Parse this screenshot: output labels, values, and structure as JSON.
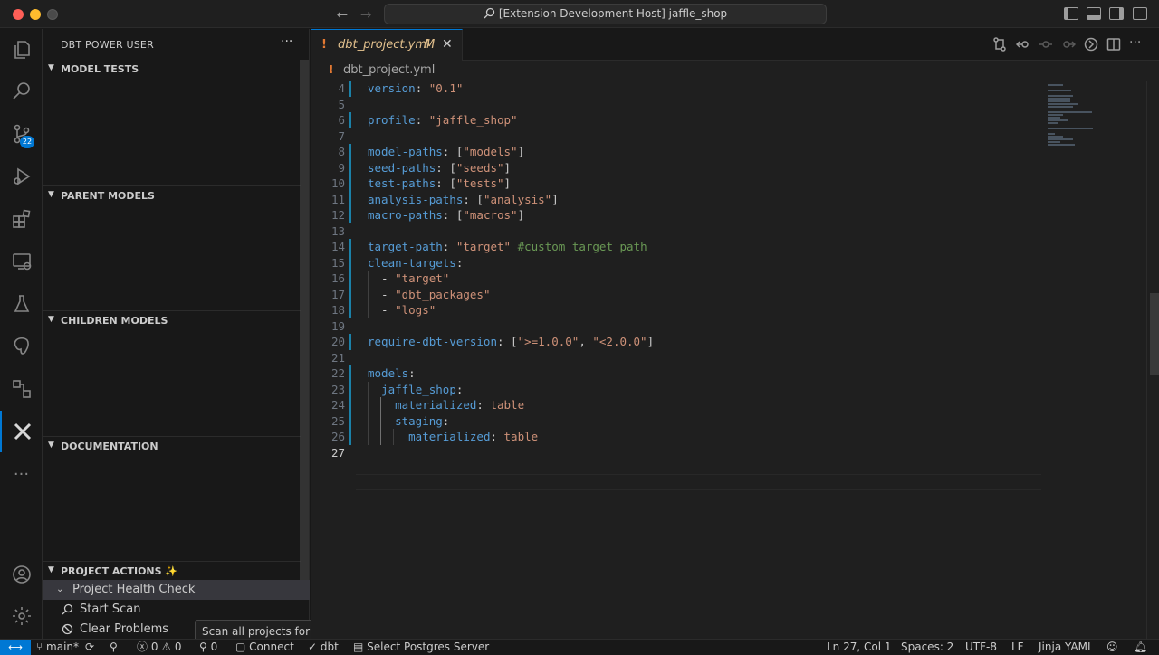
{
  "window": {
    "title": "[Extension Development Host] jaffle_shop"
  },
  "activity": {
    "scm_badge": "22"
  },
  "sidebar": {
    "title": "DBT POWER USER",
    "sections": {
      "model_tests": "MODEL TESTS",
      "parent_models": "PARENT MODELS",
      "children_models": "CHILDREN MODELS",
      "documentation": "DOCUMENTATION",
      "project_actions": "PROJECT ACTIONS ✨"
    },
    "tree": {
      "health_check": "Project Health Check",
      "start_scan": "Start Scan",
      "clear_problems": "Clear Problems"
    },
    "tooltip": "Scan all projects for issues"
  },
  "editor": {
    "tab": {
      "name": "dbt_project.yml",
      "modified": "M"
    },
    "breadcrumb": "dbt_project.yml",
    "lines": [
      {
        "n": "4",
        "t": [
          [
            "k",
            "version"
          ],
          [
            "p",
            ": "
          ],
          [
            "s",
            "\"0.1\""
          ]
        ]
      },
      {
        "n": "5",
        "t": []
      },
      {
        "n": "6",
        "t": [
          [
            "k",
            "profile"
          ],
          [
            "p",
            ": "
          ],
          [
            "s",
            "\"jaffle_shop\""
          ]
        ]
      },
      {
        "n": "7",
        "t": []
      },
      {
        "n": "8",
        "t": [
          [
            "k",
            "model-paths"
          ],
          [
            "p",
            ": ["
          ],
          [
            "s",
            "\"models\""
          ],
          [
            "p",
            "]"
          ]
        ]
      },
      {
        "n": "9",
        "t": [
          [
            "k",
            "seed-paths"
          ],
          [
            "p",
            ": ["
          ],
          [
            "s",
            "\"seeds\""
          ],
          [
            "p",
            "]"
          ]
        ]
      },
      {
        "n": "10",
        "t": [
          [
            "k",
            "test-paths"
          ],
          [
            "p",
            ": ["
          ],
          [
            "s",
            "\"tests\""
          ],
          [
            "p",
            "]"
          ]
        ]
      },
      {
        "n": "11",
        "t": [
          [
            "k",
            "analysis-paths"
          ],
          [
            "p",
            ": ["
          ],
          [
            "s",
            "\"analysis\""
          ],
          [
            "p",
            "]"
          ]
        ]
      },
      {
        "n": "12",
        "t": [
          [
            "k",
            "macro-paths"
          ],
          [
            "p",
            ": ["
          ],
          [
            "s",
            "\"macros\""
          ],
          [
            "p",
            "]"
          ]
        ]
      },
      {
        "n": "13",
        "t": []
      },
      {
        "n": "14",
        "t": [
          [
            "k",
            "target-path"
          ],
          [
            "p",
            ": "
          ],
          [
            "s",
            "\"target\""
          ],
          [
            "p",
            " "
          ],
          [
            "c",
            "#custom target path"
          ]
        ]
      },
      {
        "n": "15",
        "t": [
          [
            "k",
            "clean-targets"
          ],
          [
            "p",
            ":"
          ]
        ]
      },
      {
        "n": "16",
        "t": [
          [
            "p",
            "  - "
          ],
          [
            "s",
            "\"target\""
          ]
        ]
      },
      {
        "n": "17",
        "t": [
          [
            "p",
            "  - "
          ],
          [
            "s",
            "\"dbt_packages\""
          ]
        ]
      },
      {
        "n": "18",
        "t": [
          [
            "p",
            "  - "
          ],
          [
            "s",
            "\"logs\""
          ]
        ]
      },
      {
        "n": "19",
        "t": []
      },
      {
        "n": "20",
        "t": [
          [
            "k",
            "require-dbt-version"
          ],
          [
            "p",
            ": ["
          ],
          [
            "s",
            "\">=1.0.0\""
          ],
          [
            "p",
            ", "
          ],
          [
            "s",
            "\"<2.0.0\""
          ],
          [
            "p",
            "]"
          ]
        ]
      },
      {
        "n": "21",
        "t": []
      },
      {
        "n": "22",
        "t": [
          [
            "k",
            "models"
          ],
          [
            "p",
            ":"
          ]
        ]
      },
      {
        "n": "23",
        "t": [
          [
            "p",
            "  "
          ],
          [
            "k",
            "jaffle_shop"
          ],
          [
            "p",
            ":"
          ]
        ]
      },
      {
        "n": "24",
        "t": [
          [
            "p",
            "    "
          ],
          [
            "k",
            "materialized"
          ],
          [
            "p",
            ": "
          ],
          [
            "s",
            "table"
          ]
        ]
      },
      {
        "n": "25",
        "t": [
          [
            "p",
            "    "
          ],
          [
            "k",
            "staging"
          ],
          [
            "p",
            ":"
          ]
        ]
      },
      {
        "n": "26",
        "t": [
          [
            "p",
            "      "
          ],
          [
            "k",
            "materialized"
          ],
          [
            "p",
            ": "
          ],
          [
            "s",
            "table"
          ]
        ]
      },
      {
        "n": "27",
        "t": []
      }
    ]
  },
  "statusbar": {
    "branch": "main*",
    "errors": "0",
    "warnings": "0",
    "ports": "0",
    "connect": "Connect",
    "dbt": "dbt",
    "db": "Select Postgres Server",
    "position": "Ln 27, Col 1",
    "spaces": "Spaces: 2",
    "encoding": "UTF-8",
    "eol": "LF",
    "language": "Jinja YAML"
  }
}
